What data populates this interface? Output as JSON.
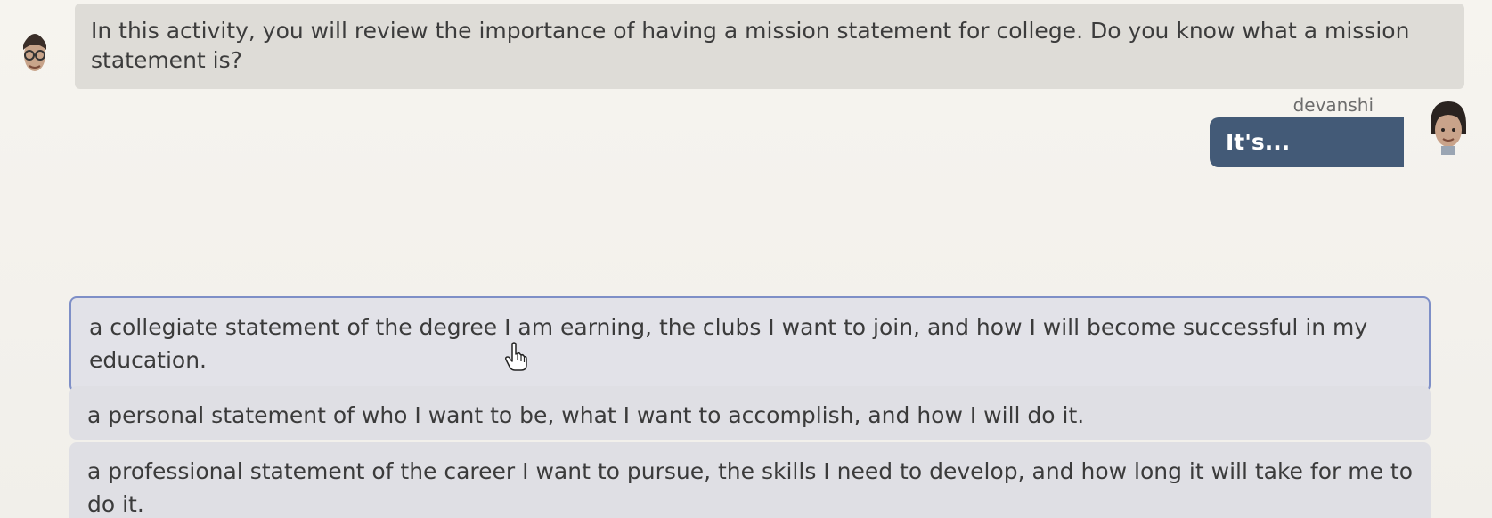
{
  "prompt": {
    "text": "In this activity, you will review the importance of having a mission statement for college. Do you know what a mission statement is?"
  },
  "user": {
    "name": "devanshi",
    "reply": "It's..."
  },
  "options": [
    {
      "text": "a collegiate statement of the degree I am earning, the clubs I want to join, and how I will become successful in my education.",
      "hovered": true
    },
    {
      "text": "a personal statement of who I want to be, what I want to accomplish, and how I will do it.",
      "hovered": false
    },
    {
      "text": "a professional statement of the career I want to pursue, the skills I need to develop, and how long it will take for me to do it.",
      "hovered": false
    }
  ],
  "colors": {
    "reply_bubble": "#435a77",
    "prompt_bubble": "#dedcd7",
    "option_bg": "#dfdfe4",
    "selected_border": "#7e8fc7"
  },
  "icons": {
    "bot_avatar": "glasses-character-icon",
    "user_avatar": "girl-character-icon",
    "cursor": "hand-pointer-icon"
  }
}
